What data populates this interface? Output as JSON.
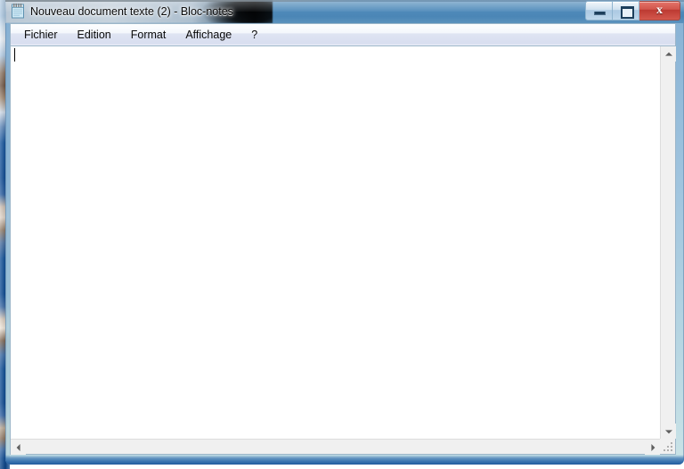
{
  "window": {
    "title": "Nouveau document texte (2) - Bloc-notes",
    "icon": "notepad-icon",
    "controls": {
      "minimize_label": "–",
      "maximize_label": "□",
      "close_label": "✕",
      "minimize_name": "minimize-button",
      "maximize_name": "maximize-button",
      "close_name": "close-button"
    }
  },
  "menubar": {
    "items": [
      {
        "label": "Fichier"
      },
      {
        "label": "Edition"
      },
      {
        "label": "Format"
      },
      {
        "label": "Affichage"
      },
      {
        "label": "?"
      }
    ]
  },
  "editor": {
    "content": "",
    "caret_visible": true
  },
  "scrollbars": {
    "vertical": {
      "up_arrow": "▲",
      "down_arrow": "▼"
    },
    "horizontal": {
      "left_arrow": "◀",
      "right_arrow": "▶"
    }
  },
  "colors": {
    "title_glass": "#4e89b9",
    "close_button": "#bc3a32",
    "client_background": "#f0f0f0",
    "editor_background": "#ffffff",
    "menu_background": "#dfe4f2",
    "frame_border": "#9cb6c9"
  }
}
